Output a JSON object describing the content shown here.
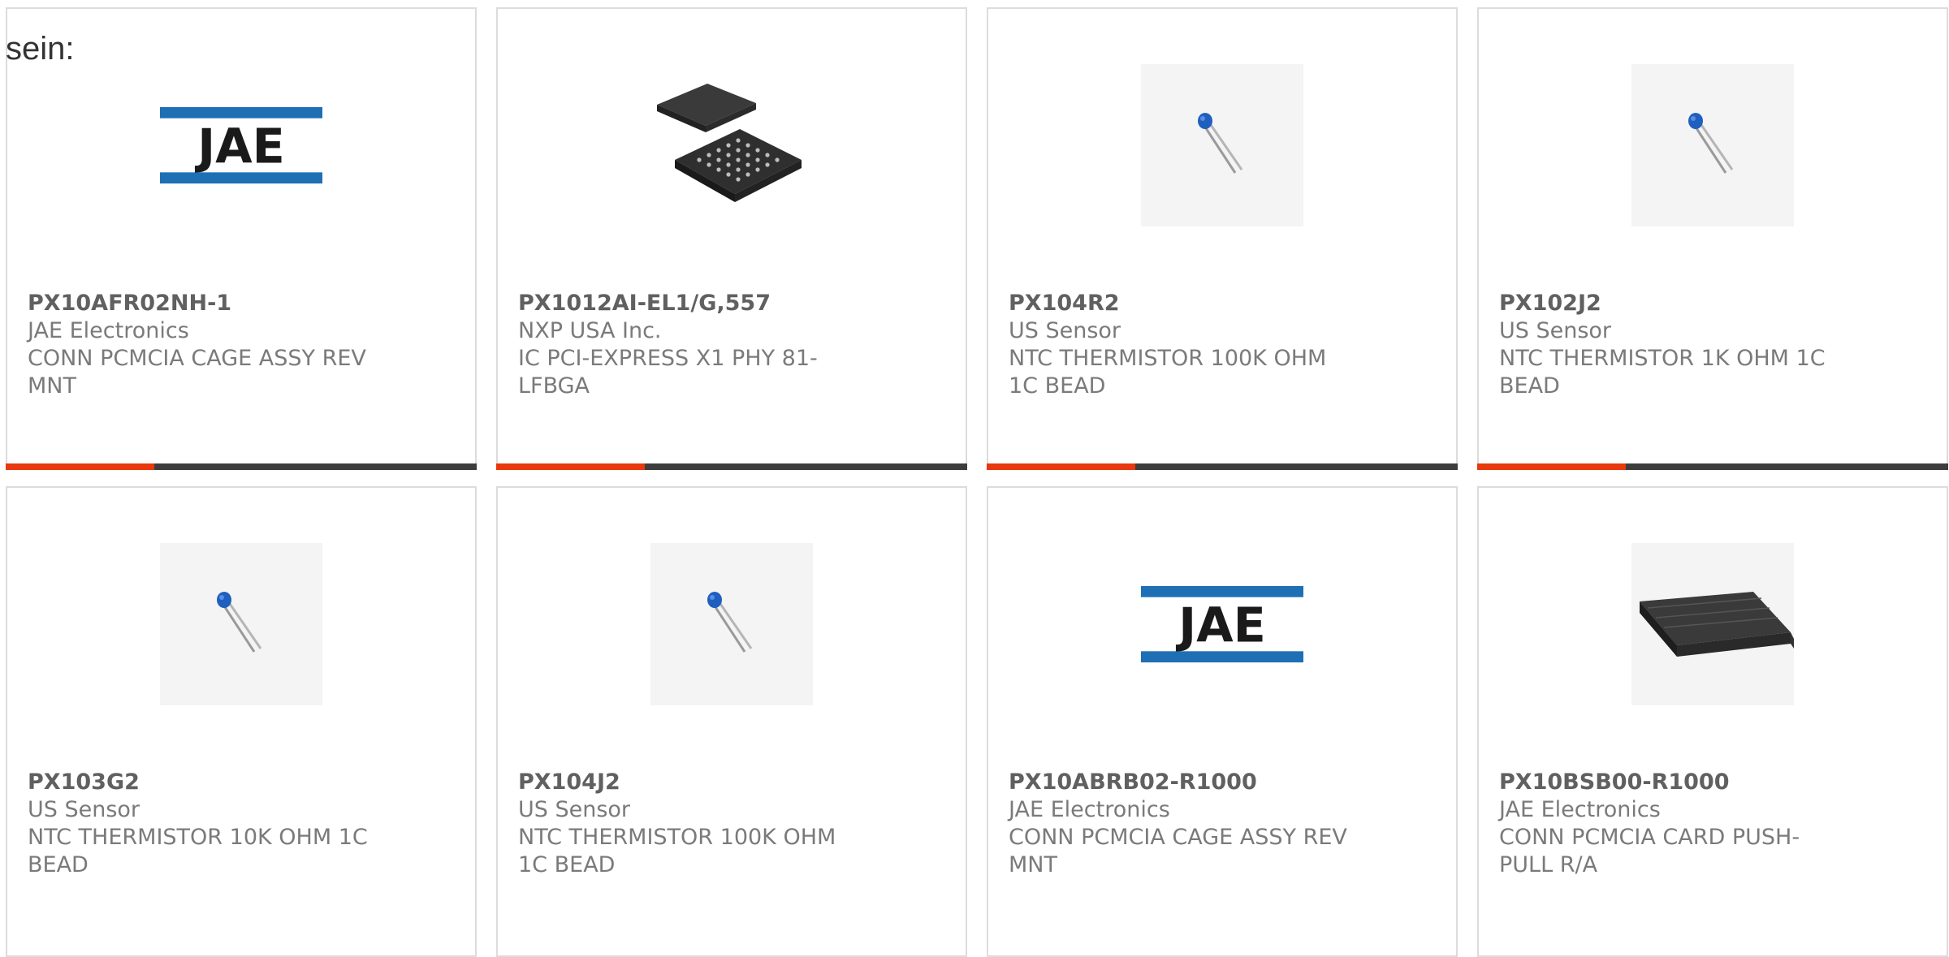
{
  "intro_text": "sein:",
  "accent_color": "#e8380d",
  "bar_color": "#3d3d3d",
  "bar_progress_fraction": 0.315,
  "products": [
    {
      "part_number": "PX10AFR02NH-1",
      "manufacturer": "JAE Electronics",
      "description": "CONN PCMCIA CAGE ASSY REV MNT",
      "image": "jae-logo"
    },
    {
      "part_number": "PX1012AI-EL1/G,557",
      "manufacturer": "NXP USA Inc.",
      "description": "IC PCI-EXPRESS X1 PHY 81-LFBGA",
      "image": "bga-chip"
    },
    {
      "part_number": "PX104R2",
      "manufacturer": "US Sensor",
      "description": "NTC THERMISTOR 100K OHM 1C BEAD",
      "image": "thermistor"
    },
    {
      "part_number": "PX102J2",
      "manufacturer": "US Sensor",
      "description": "NTC THERMISTOR 1K OHM 1C BEAD",
      "image": "thermistor"
    },
    {
      "part_number": "PX103G2",
      "manufacturer": "US Sensor",
      "description": "NTC THERMISTOR 10K OHM 1C BEAD",
      "image": "thermistor"
    },
    {
      "part_number": "PX104J2",
      "manufacturer": "US Sensor",
      "description": "NTC THERMISTOR 100K OHM 1C BEAD",
      "image": "thermistor"
    },
    {
      "part_number": "PX10ABRB02-R1000",
      "manufacturer": "JAE Electronics",
      "description": "CONN PCMCIA CAGE ASSY REV MNT",
      "image": "jae-logo"
    },
    {
      "part_number": "PX10BSB00-R1000",
      "manufacturer": "JAE Electronics",
      "description": "CONN PCMCIA CARD PUSH-PULL R/A",
      "image": "pcmcia-connector"
    }
  ]
}
